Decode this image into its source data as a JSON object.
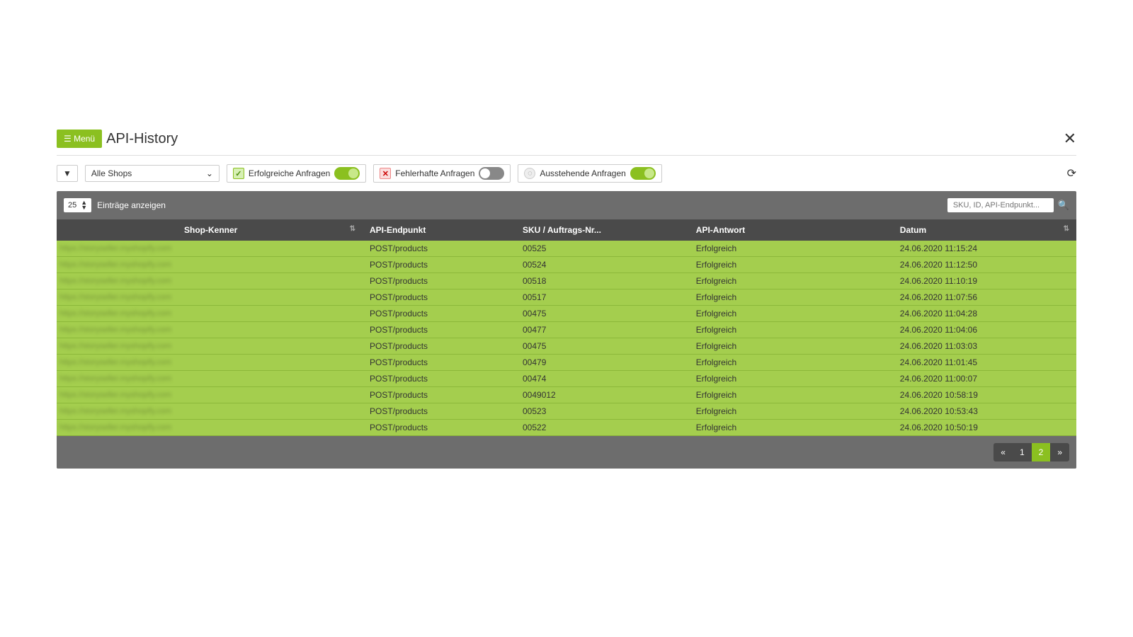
{
  "header": {
    "menu_label": "☰ Menü",
    "title": "API-History"
  },
  "filters": {
    "shop_select": "Alle Shops",
    "success_label": "Erfolgreiche Anfragen",
    "error_label": "Fehlerhafte Anfragen",
    "pending_label": "Ausstehende Anfragen",
    "success_on": true,
    "error_on": false,
    "pending_on": true
  },
  "table": {
    "page_size": "25",
    "entries_label": "Einträge anzeigen",
    "search_placeholder": "SKU, ID, API-Endpunkt...",
    "columns": {
      "shop": "Shop-Kenner",
      "endpoint": "API-Endpunkt",
      "sku": "SKU / Auftrags-Nr...",
      "response": "API-Antwort",
      "date": "Datum"
    },
    "rows": [
      {
        "shop": "https://storyseller.myshopify.com",
        "endpoint": "POST/products",
        "sku": "00525",
        "response": "Erfolgreich",
        "date": "24.06.2020 11:15:24"
      },
      {
        "shop": "https://storyseller.myshopify.com",
        "endpoint": "POST/products",
        "sku": "00524",
        "response": "Erfolgreich",
        "date": "24.06.2020 11:12:50"
      },
      {
        "shop": "https://storyseller.myshopify.com",
        "endpoint": "POST/products",
        "sku": "00518",
        "response": "Erfolgreich",
        "date": "24.06.2020 11:10:19"
      },
      {
        "shop": "https://storyseller.myshopify.com",
        "endpoint": "POST/products",
        "sku": "00517",
        "response": "Erfolgreich",
        "date": "24.06.2020 11:07:56"
      },
      {
        "shop": "https://storyseller.myshopify.com",
        "endpoint": "POST/products",
        "sku": "00475",
        "response": "Erfolgreich",
        "date": "24.06.2020 11:04:28"
      },
      {
        "shop": "https://storyseller.myshopify.com",
        "endpoint": "POST/products",
        "sku": "00477",
        "response": "Erfolgreich",
        "date": "24.06.2020 11:04:06"
      },
      {
        "shop": "https://storyseller.myshopify.com",
        "endpoint": "POST/products",
        "sku": "00475",
        "response": "Erfolgreich",
        "date": "24.06.2020 11:03:03"
      },
      {
        "shop": "https://storyseller.myshopify.com",
        "endpoint": "POST/products",
        "sku": "00479",
        "response": "Erfolgreich",
        "date": "24.06.2020 11:01:45"
      },
      {
        "shop": "https://storyseller.myshopify.com",
        "endpoint": "POST/products",
        "sku": "00474",
        "response": "Erfolgreich",
        "date": "24.06.2020 11:00:07"
      },
      {
        "shop": "https://storyseller.myshopify.com",
        "endpoint": "POST/products",
        "sku": "0049012",
        "response": "Erfolgreich",
        "date": "24.06.2020 10:58:19"
      },
      {
        "shop": "https://storyseller.myshopify.com",
        "endpoint": "POST/products",
        "sku": "00523",
        "response": "Erfolgreich",
        "date": "24.06.2020 10:53:43"
      },
      {
        "shop": "https://storyseller.myshopify.com",
        "endpoint": "POST/products",
        "sku": "00522",
        "response": "Erfolgreich",
        "date": "24.06.2020 10:50:19"
      }
    ]
  },
  "pagination": {
    "pages": [
      "1",
      "2"
    ],
    "active": "2"
  }
}
